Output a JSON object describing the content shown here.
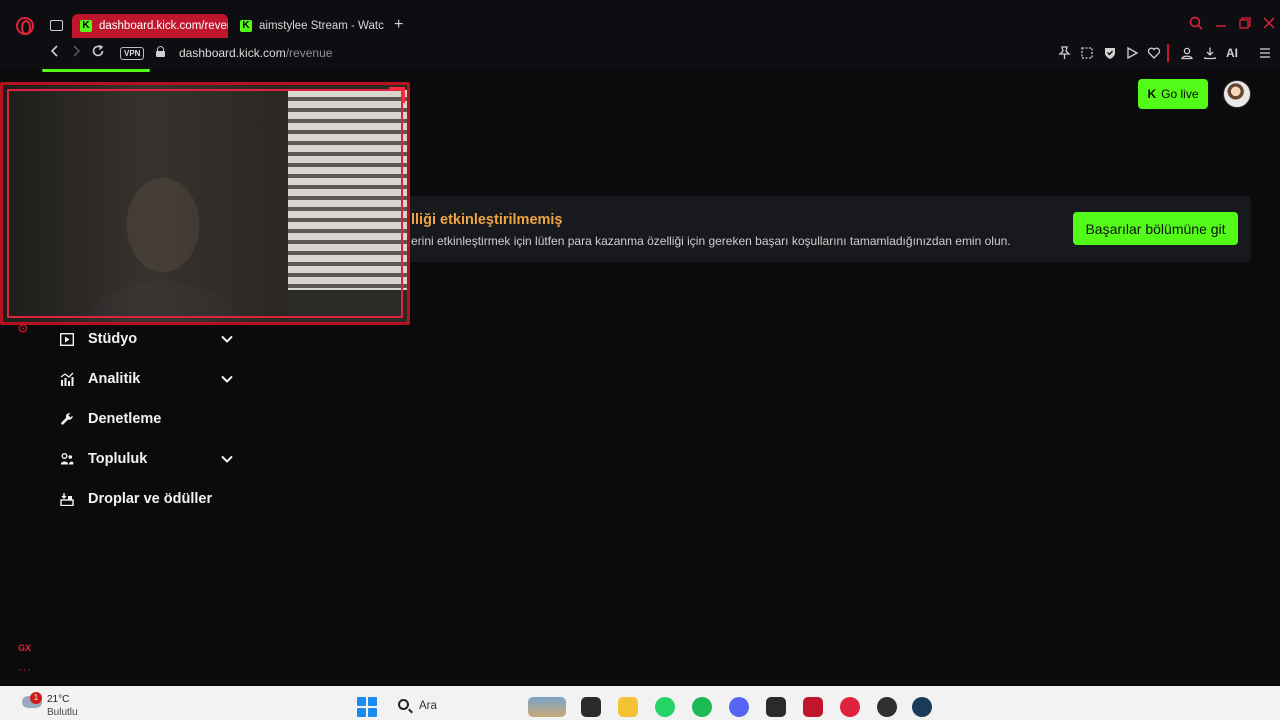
{
  "browser": {
    "tabs": [
      {
        "title": "dashboard.kick.com/revenue",
        "active": true
      },
      {
        "title": "aimstylee Stream - Watch L",
        "active": false
      }
    ],
    "url_domain": "dashboard.kick.com",
    "url_path": "/revenue",
    "full_url": "dashboard.kick.com/revenue",
    "vpn_label": "VPN",
    "ai_label": "AI",
    "sidebar_label": "GX",
    "accent_color": "#e0233c"
  },
  "header": {
    "go_live_label": "Go live",
    "go_live_icon": "K",
    "go_live_color": "#53fc18"
  },
  "banner": {
    "title": "lliği etkinleştirilmemiş",
    "description": "erini etkinleştirmek için lütfen para kazanma özelliği için gereken başarı koşullarını tamamladığınızdan emin olun.",
    "button_label": "Başarılar bölümüne git",
    "title_color": "#f0a544"
  },
  "menu": {
    "items": [
      {
        "label": "Stüdyo",
        "icon": "studio-icon",
        "expandable": true
      },
      {
        "label": "Analitik",
        "icon": "analytics-icon",
        "expandable": true
      },
      {
        "label": "Denetleme",
        "icon": "wrench-icon",
        "expandable": false
      },
      {
        "label": "Topluluk",
        "icon": "community-icon",
        "expandable": true
      },
      {
        "label": "Droplar ve ödüller",
        "icon": "drops-icon",
        "expandable": false
      }
    ]
  },
  "taskbar": {
    "weather_temp": "21°C",
    "weather_condition": "Bulutlu",
    "weather_badge": "1",
    "search_placeholder": "Ara",
    "apps": [
      "file-explorer-icon",
      "whatsapp-icon",
      "spotify-icon",
      "discord-icon",
      "epic-games-icon",
      "opera-gx-icon",
      "obs-icon",
      "steam-icon"
    ]
  }
}
